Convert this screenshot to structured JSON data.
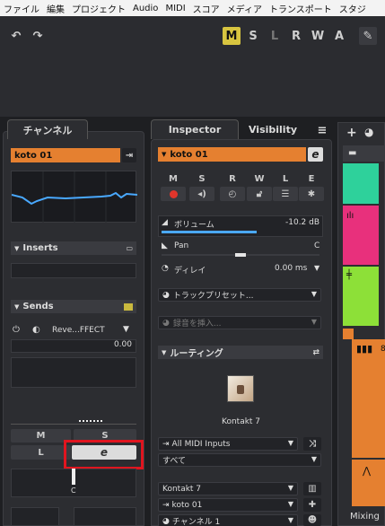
{
  "menu": [
    "ファイル",
    "編集",
    "プロジェクト",
    "Audio",
    "MIDI",
    "スコア",
    "メディア",
    "トランスポート",
    "スタジ"
  ],
  "toolbar": {
    "undo": "↶",
    "redo": "↷",
    "m": "M",
    "s": "S",
    "l": "L",
    "r": "R",
    "w": "W",
    "a": "A"
  },
  "channel": {
    "tab": "チャンネル",
    "track": "koto 01",
    "inserts": "Inserts",
    "sends": "Sends",
    "send_name": "Reve...FFECT",
    "send_value": "0.00",
    "m": "M",
    "s": "S",
    "l": "L",
    "e": "e",
    "pan": "C"
  },
  "inspector": {
    "tab": "Inspector",
    "tab2": "Visibility",
    "track": "koto 01",
    "e": "e",
    "btns": {
      "m": "M",
      "s": "S",
      "r": "R",
      "w": "W",
      "l": "L",
      "e": "E"
    },
    "volume_label": "ボリューム",
    "volume_value": "-10.2 dB",
    "volume_level": 0.6,
    "pan_label": "Pan",
    "pan_value": "C",
    "pan_level": 0.5,
    "delay_label": "ディレイ",
    "delay_value": "0.00 ms",
    "preset": "トラックプリセット...",
    "insert": "録音を挿入...",
    "routing": "ルーティング",
    "instrument": "Kontakt 7",
    "input": "All MIDI Inputs",
    "channel_in": "すべて",
    "output": "Kontakt 7",
    "out_track": "koto 01",
    "out_channel": "チャンネル 1"
  },
  "right": {
    "mixing": "Mixing",
    "num": "8"
  },
  "colors": {
    "accent": "#e58030",
    "record": "#e0352b",
    "highlight": "#e0151f"
  }
}
